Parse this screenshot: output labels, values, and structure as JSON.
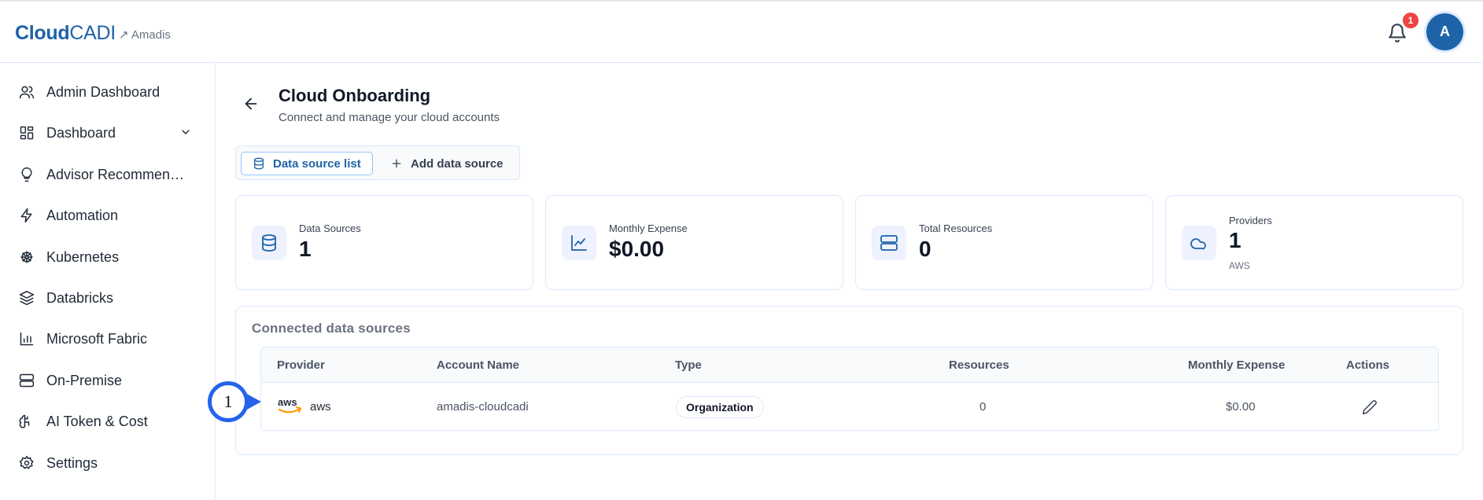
{
  "header": {
    "logo_bold": "Cloud",
    "logo_light": "CADI",
    "tenant": "↗ Amadis",
    "notification_count": "1",
    "avatar_initial": "A"
  },
  "sidebar": {
    "items": [
      {
        "label": "Admin Dashboard",
        "icon": "users-icon"
      },
      {
        "label": "Dashboard",
        "icon": "grid-icon"
      },
      {
        "label": "Advisor Recommend...",
        "icon": "lightbulb-icon"
      },
      {
        "label": "Automation",
        "icon": "lightning-icon"
      },
      {
        "label": "Kubernetes",
        "icon": "helm-icon"
      },
      {
        "label": "Databricks",
        "icon": "layers-icon"
      },
      {
        "label": "Microsoft Fabric",
        "icon": "bar-chart-icon"
      },
      {
        "label": "On-Premise",
        "icon": "server-icon"
      },
      {
        "label": "AI Token & Cost",
        "icon": "brain-icon"
      },
      {
        "label": "Settings",
        "icon": "gear-icon"
      }
    ]
  },
  "page": {
    "title": "Cloud Onboarding",
    "subtitle": "Connect and manage your cloud accounts"
  },
  "tabs": {
    "list": "Data source list",
    "add": "Add data source"
  },
  "stats": [
    {
      "label": "Data Sources",
      "value": "1"
    },
    {
      "label": "Monthly Expense",
      "value": "$0.00"
    },
    {
      "label": "Total Resources",
      "value": "0"
    },
    {
      "label": "Providers",
      "value": "1",
      "note": "AWS"
    }
  ],
  "connected": {
    "title": "Connected data sources",
    "columns": {
      "provider": "Provider",
      "account": "Account Name",
      "type": "Type",
      "resources": "Resources",
      "expense": "Monthly Expense",
      "actions": "Actions"
    },
    "rows": [
      {
        "provider_logo": "aws",
        "provider": "aws",
        "account": "amadis-cloudcadi",
        "type": "Organization",
        "resources": "0",
        "expense": "$0.00"
      }
    ]
  },
  "marker": {
    "label": "1"
  },
  "colors": {
    "brand": "#1e63a8",
    "accent_border": "#dbeafe",
    "badge_red": "#ef4444",
    "marker_blue": "#2563eb"
  }
}
